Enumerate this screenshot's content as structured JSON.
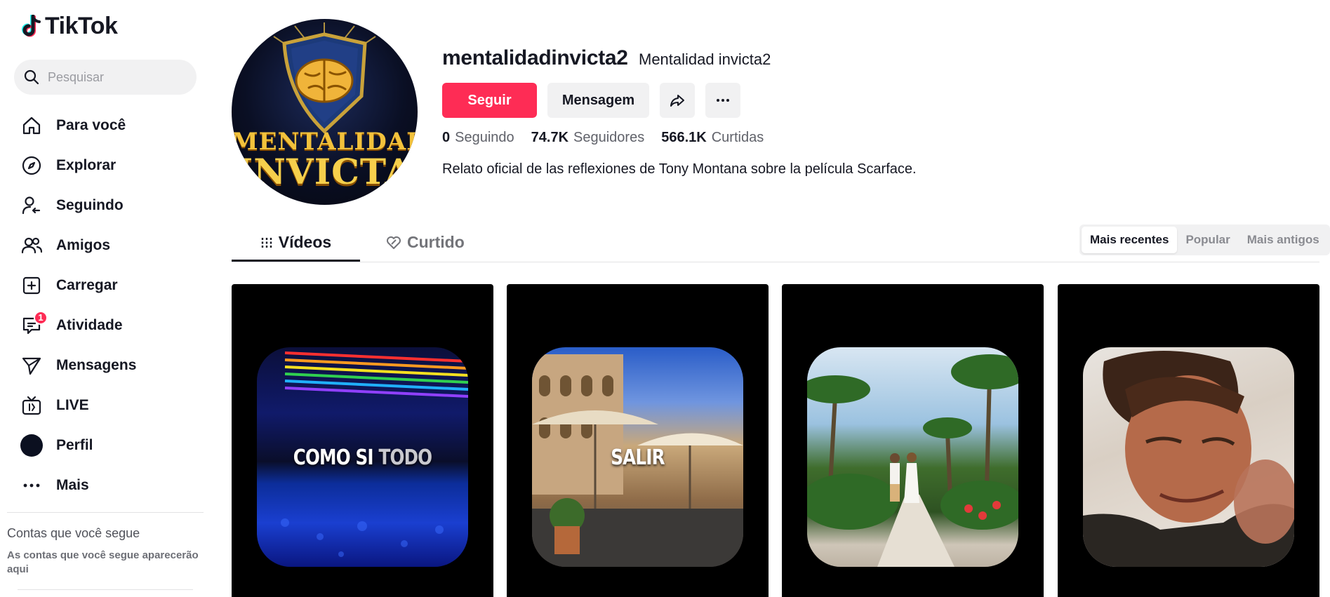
{
  "app": {
    "logo_text": "TikTok"
  },
  "search": {
    "placeholder": "Pesquisar"
  },
  "sidebar": {
    "items": [
      {
        "label": "Para você",
        "icon": "home-icon"
      },
      {
        "label": "Explorar",
        "icon": "compass-icon"
      },
      {
        "label": "Seguindo",
        "icon": "following-icon"
      },
      {
        "label": "Amigos",
        "icon": "friends-icon"
      },
      {
        "label": "Carregar",
        "icon": "upload-icon"
      },
      {
        "label": "Atividade",
        "icon": "activity-icon",
        "badge": "1"
      },
      {
        "label": "Mensagens",
        "icon": "messages-icon"
      },
      {
        "label": "LIVE",
        "icon": "live-icon"
      },
      {
        "label": "Perfil",
        "icon": "profile-avatar-icon"
      },
      {
        "label": "Mais",
        "icon": "more-icon"
      }
    ],
    "following_title": "Contas que você segue",
    "following_hint": "As contas que você segue aparecerão aqui"
  },
  "profile": {
    "username": "mentalidadinvicta2",
    "nickname": "Mentalidad invicta2",
    "avatar_text_1": "MENTALIDAD",
    "avatar_text_2": "INVICTA",
    "follow_label": "Seguir",
    "message_label": "Mensagem",
    "stats": {
      "following_count": "0",
      "following_label": "Seguindo",
      "followers_count": "74.7K",
      "followers_label": "Seguidores",
      "likes_count": "566.1K",
      "likes_label": "Curtidas"
    },
    "bio": "Relato oficial de las reflexiones de Tony Montana sobre la película Scarface."
  },
  "tabs": {
    "videos": "Vídeos",
    "liked": "Curtido"
  },
  "sort": {
    "recent": "Mais recentes",
    "popular": "Popular",
    "oldest": "Mais antigos"
  },
  "videos": [
    {
      "caption_a": "COMO SI ",
      "caption_b": "TODO"
    },
    {
      "caption_a": "SALIR",
      "caption_b": ""
    },
    {
      "caption_a": "",
      "caption_b": ""
    },
    {
      "caption_a": "",
      "caption_b": ""
    }
  ],
  "colors": {
    "accent": "#fe2c55",
    "text": "#161823",
    "muted": "#737479",
    "surface": "#f1f1f2"
  }
}
